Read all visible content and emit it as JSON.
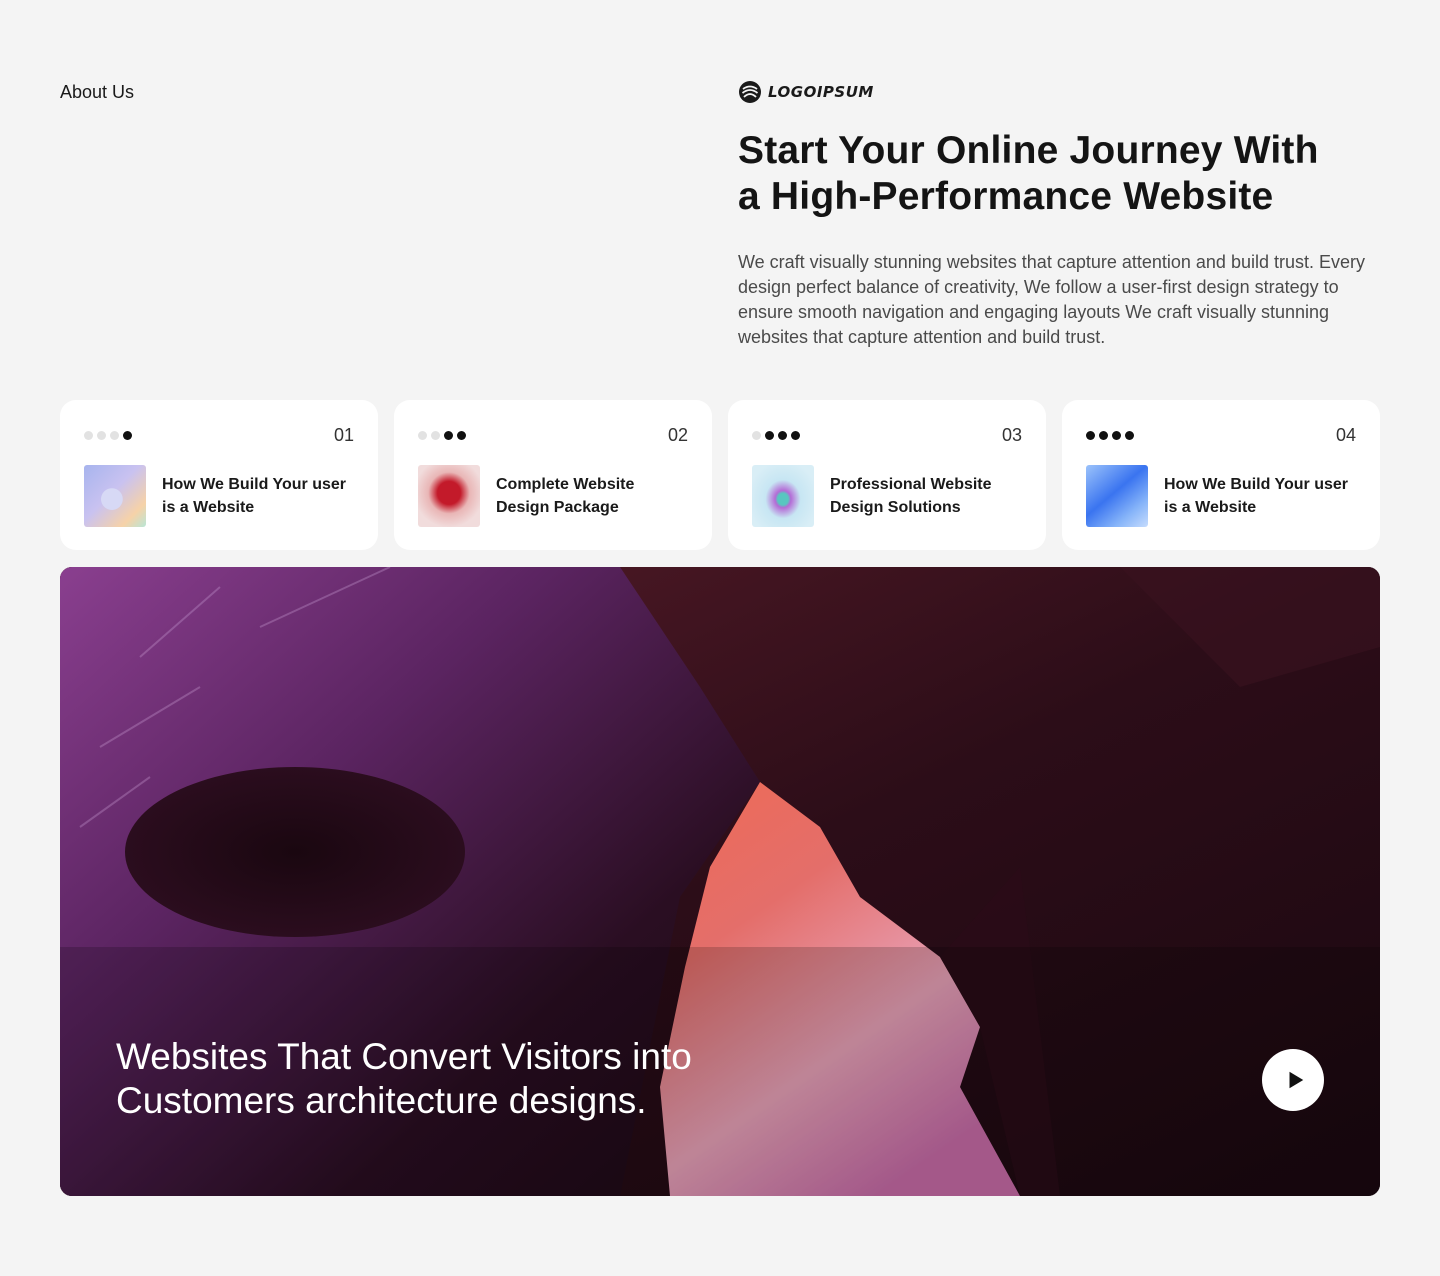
{
  "about": {
    "label": "About Us"
  },
  "brand": {
    "logo_text": "LOGOIPSUM",
    "logo_icon": "logo-swirl-icon"
  },
  "hero": {
    "title": "Start Your Online Journey With a High-Performance Website",
    "description": "We craft visually stunning websites that capture attention and build trust. Every design perfect balance of creativity, We follow a user-first design strategy to ensure smooth navigation and engaging layouts We craft visually stunning websites that capture attention and build trust."
  },
  "cards": [
    {
      "number": "01",
      "title": "How We Build Your user is a Website",
      "active_dots": 1,
      "total_dots": 4
    },
    {
      "number": "02",
      "title": "Complete Website Design Package",
      "active_dots": 2,
      "total_dots": 4
    },
    {
      "number": "03",
      "title": "Professional Website Design Solutions",
      "active_dots": 3,
      "total_dots": 4
    },
    {
      "number": "04",
      "title": "How We Build Your user is a Website",
      "active_dots": 4,
      "total_dots": 4
    }
  ],
  "media": {
    "caption": "Websites That Convert Visitors into Customers architecture designs.",
    "play_icon": "play-icon"
  },
  "colors": {
    "background": "#f4f4f4",
    "card": "#ffffff",
    "text": "#141414"
  }
}
